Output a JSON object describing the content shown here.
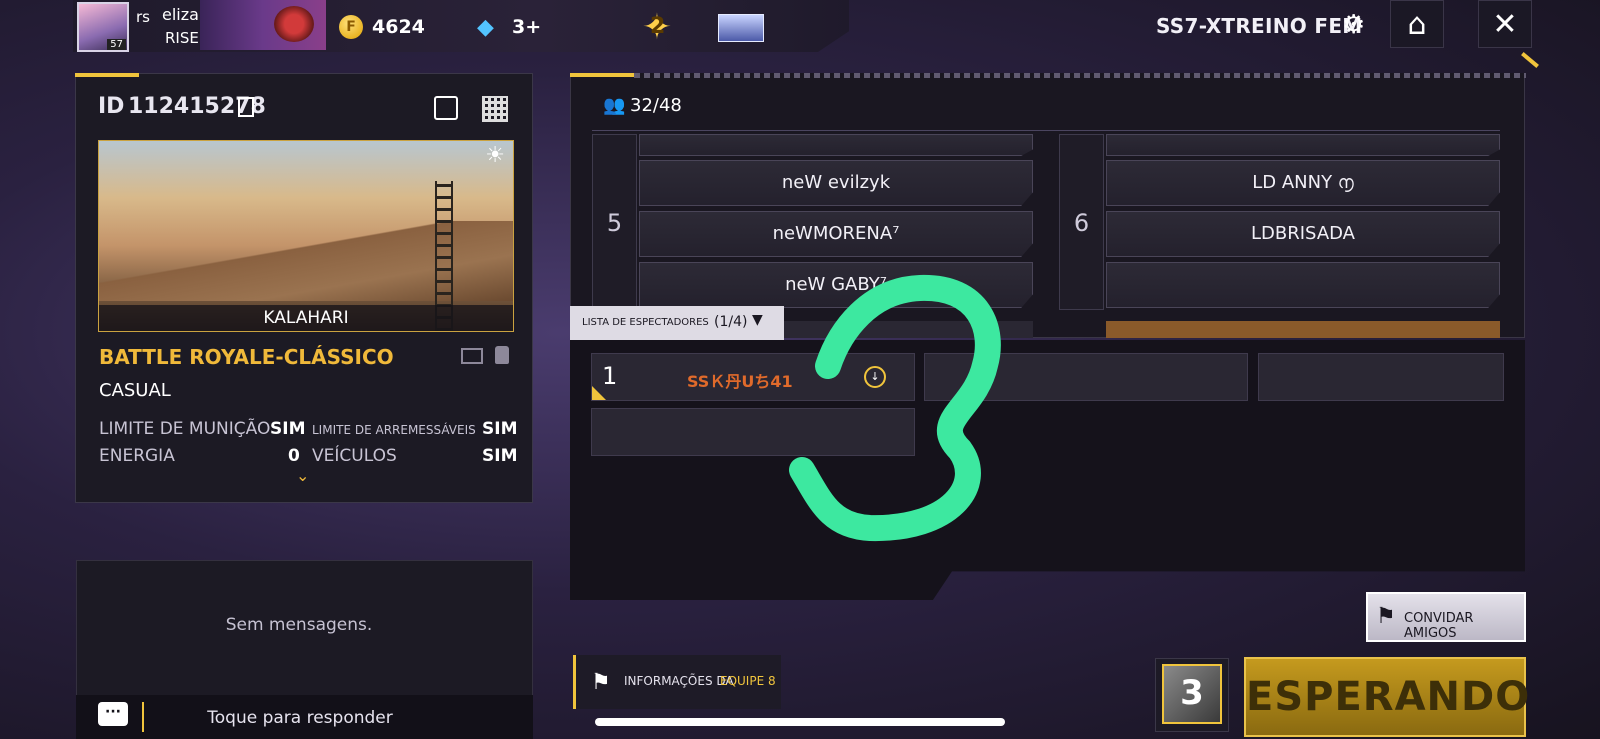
{
  "header": {
    "player_tag": "rs",
    "player_name": "eliza♡",
    "guild_name": "RISEN",
    "level": "57",
    "coins": "4624",
    "diamonds": "3+",
    "rank_tier": "2",
    "room_name": "SS7-XTREINO FEM",
    "icons": {
      "settings": "gear-icon",
      "home": "home-icon",
      "close": "close-icon"
    }
  },
  "room_info": {
    "id_label": "ID",
    "id_value": "112415278",
    "map_name": "KALAHARI",
    "mode": "BATTLE ROYALE-CLÁSSICO",
    "type": "CASUAL",
    "rules": [
      {
        "label": "LIMITE DE MUNIÇÃO",
        "value": "SIM"
      },
      {
        "label": "LIMITE DE ARREMESSÁVEIS",
        "value": "SIM"
      },
      {
        "label": "ENERGIA",
        "value": "0"
      },
      {
        "label": "VEÍCULOS",
        "value": "SIM"
      }
    ]
  },
  "chat": {
    "empty_text": "Sem mensagens.",
    "reply_placeholder": "Toque para responder"
  },
  "teams": {
    "player_count": "32/48",
    "team_5": {
      "number": "5",
      "players": [
        "neW  evilzyk",
        "neWMORENA⁷",
        "neW   GABY⁷"
      ]
    },
    "team_6": {
      "number": "6",
      "players": [
        "LD    ANNY    ൱",
        "LDBRISADA",
        ""
      ]
    }
  },
  "spectators": {
    "tab_label": "LISTA DE ESPECTADORES",
    "tab_count": "(1/4)",
    "slots": [
      {
        "index": "1",
        "name": "SSＫ丹Uち41"
      }
    ]
  },
  "footer": {
    "team_info_label": "INFORMAÇÕES DA",
    "team_info_team": "EQUIPE 8",
    "invite_label": "CONVIDAR AMIGOS",
    "item_count": "3",
    "wait_label": "ESPERANDO"
  },
  "colors": {
    "accent_gold": "#f0c43c",
    "spectator_name": "#e06a2b",
    "annotation_stroke": "#3de8a0"
  }
}
